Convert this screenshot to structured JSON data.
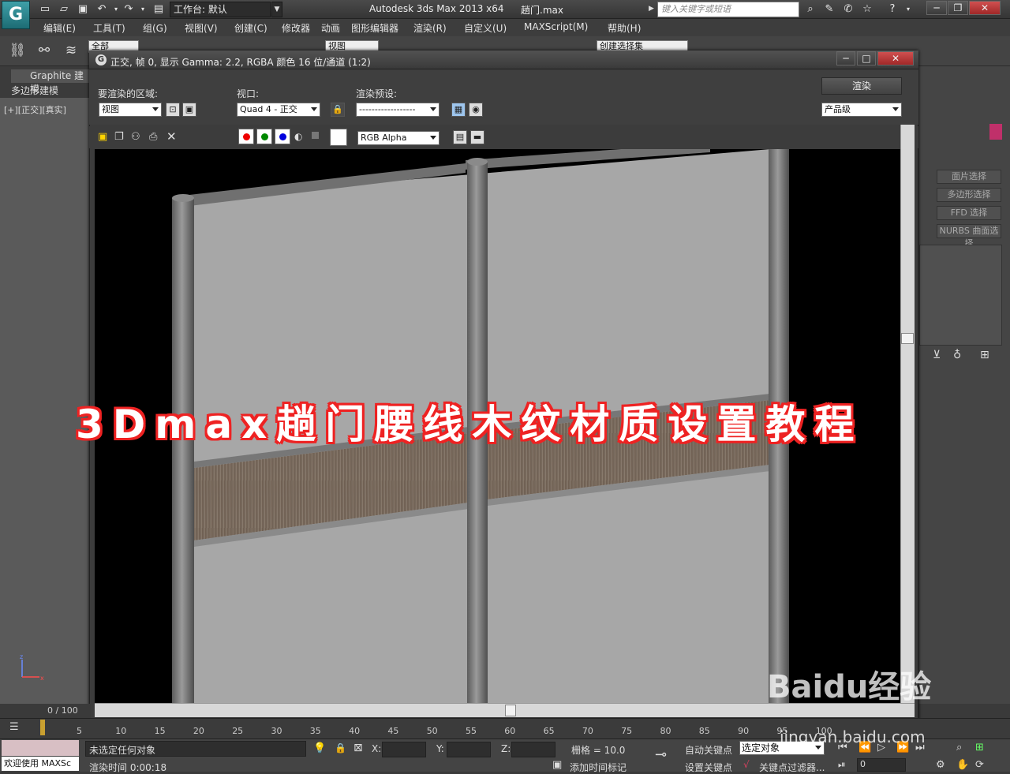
{
  "app": {
    "title": "Autodesk 3ds Max  2013 x64",
    "file": "趟门.max",
    "workspace": "工作台: 默认",
    "search_placeholder": "键入关键字或短语",
    "logo": "G"
  },
  "menu": [
    "编辑(E)",
    "工具(T)",
    "组(G)",
    "视图(V)",
    "创建(C)",
    "修改器",
    "动画",
    "图形编辑器",
    "渲染(R)",
    "自定义(U)",
    "MAXScript(M)",
    "帮助(H)"
  ],
  "toolbar": {
    "selection_filter": "全部",
    "ref_coord": "视图",
    "named_sel": "创建选择集"
  },
  "ribbon": {
    "tab": "Graphite 建模",
    "subtab": "多边形建模"
  },
  "viewport_label": "[+][正交][真实]",
  "render_window": {
    "title": "正交, 帧 0, 显示 Gamma: 2.2, RGBA 颜色 16 位/通道 (1:2)",
    "area_label": "要渲染的区域:",
    "area_value": "视图",
    "viewport_label": "视口:",
    "viewport_value": "Quad 4 - 正交",
    "preset_label": "渲染预设:",
    "preset_value": "------------------",
    "render_button": "渲染",
    "quality_value": "产品级",
    "channel_value": "RGB Alpha"
  },
  "overlay_title": "3Dmax趟门腰线木纹材质设置教程",
  "command_panel": {
    "buttons": [
      "面片选择",
      "多边形选择",
      "FFD 选择",
      "NURBS 曲面选择"
    ]
  },
  "timeline": {
    "frame": "0 / 100",
    "ticks": [
      "5",
      "10",
      "15",
      "20",
      "25",
      "30",
      "35",
      "40",
      "45",
      "50",
      "55",
      "60",
      "65",
      "70",
      "75",
      "80",
      "85",
      "90",
      "95",
      "100"
    ]
  },
  "status": {
    "welcome": "欢迎使用 MAXSc",
    "selection": "未选定任何对象",
    "render_time": "渲染时间 0:00:18",
    "x_label": "X:",
    "y_label": "Y:",
    "z_label": "Z:",
    "grid": "栅格 = 10.0",
    "autokey": "自动关键点",
    "setkey": "设置关键点",
    "selected": "选定对象",
    "key_filter": "关键点过滤器...",
    "add_time_tag": "添加时间标记",
    "frame_field": "0"
  },
  "watermark": {
    "brand": "Baidu经验",
    "url": "jingyan.baidu.com"
  },
  "colors": {
    "accent": "#3fa0a8",
    "overlay_outline": "#e22222",
    "panel": "#3c3c3c"
  }
}
